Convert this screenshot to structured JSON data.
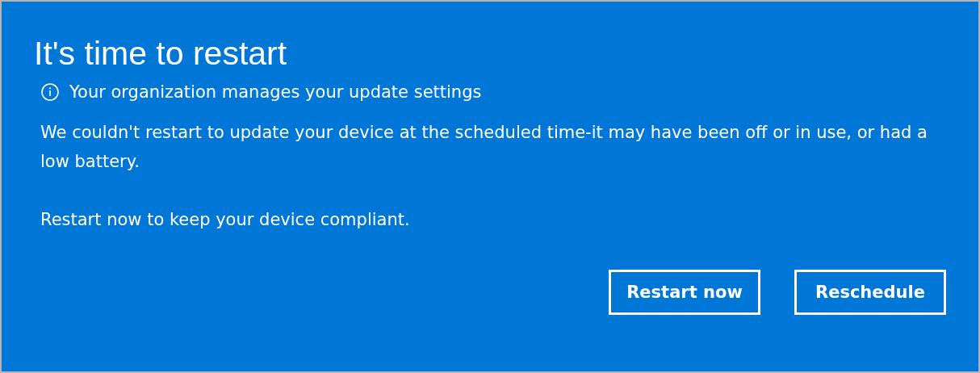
{
  "dialog": {
    "title": "It's time to restart",
    "notice": "Your organization manages your update settings",
    "paragraphs": [
      "We couldn't restart to update your device at the scheduled time-it may have been off or in use, or had a low battery.",
      "Restart now to keep your device compliant."
    ],
    "buttons": [
      "Restart now",
      "Reschedule"
    ]
  }
}
